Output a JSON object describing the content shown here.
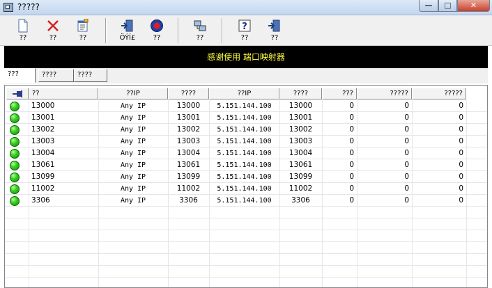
{
  "window": {
    "title": "?????"
  },
  "toolbar": {
    "buttons": [
      {
        "label": "??",
        "icon": "new-file-icon"
      },
      {
        "label": "??",
        "icon": "delete-x-icon"
      },
      {
        "label": "??",
        "icon": "properties-icon"
      },
      {
        "label": "ÖÝÍ£",
        "icon": "exit-door-icon"
      },
      {
        "label": "??",
        "icon": "stop-icon"
      },
      {
        "label": "??",
        "icon": "network-icon"
      },
      {
        "label": "??",
        "icon": "help-icon"
      },
      {
        "label": "??",
        "icon": "exit-door-icon"
      }
    ]
  },
  "banner": {
    "text": "感谢使用 端口映射器"
  },
  "tabs": [
    "???",
    "????",
    "????"
  ],
  "table": {
    "headers": [
      "",
      "??",
      "??IP",
      "????",
      "??IP",
      "????",
      "???",
      "?????",
      "?????"
    ],
    "rows": [
      [
        "13000",
        "Any IP",
        "13000",
        "5.151.144.100",
        "13000",
        "0",
        "0",
        "0"
      ],
      [
        "13001",
        "Any IP",
        "13001",
        "5.151.144.100",
        "13001",
        "0",
        "0",
        "0"
      ],
      [
        "13002",
        "Any IP",
        "13002",
        "5.151.144.100",
        "13002",
        "0",
        "0",
        "0"
      ],
      [
        "13003",
        "Any IP",
        "13003",
        "5.151.144.100",
        "13003",
        "0",
        "0",
        "0"
      ],
      [
        "13004",
        "Any IP",
        "13004",
        "5.151.144.100",
        "13004",
        "0",
        "0",
        "0"
      ],
      [
        "13061",
        "Any IP",
        "13061",
        "5.151.144.100",
        "13061",
        "0",
        "0",
        "0"
      ],
      [
        "13099",
        "Any IP",
        "13099",
        "5.151.144.100",
        "13099",
        "0",
        "0",
        "0"
      ],
      [
        "11002",
        "Any IP",
        "11002",
        "5.151.144.100",
        "11002",
        "0",
        "0",
        "0"
      ],
      [
        "3306",
        "Any IP",
        "3306",
        "5.151.144.100",
        "3306",
        "0",
        "0",
        "0"
      ]
    ]
  },
  "colors": {
    "banner_bg": "#000000",
    "banner_text": "#ffff40",
    "status_ok": "#2fc41b"
  }
}
